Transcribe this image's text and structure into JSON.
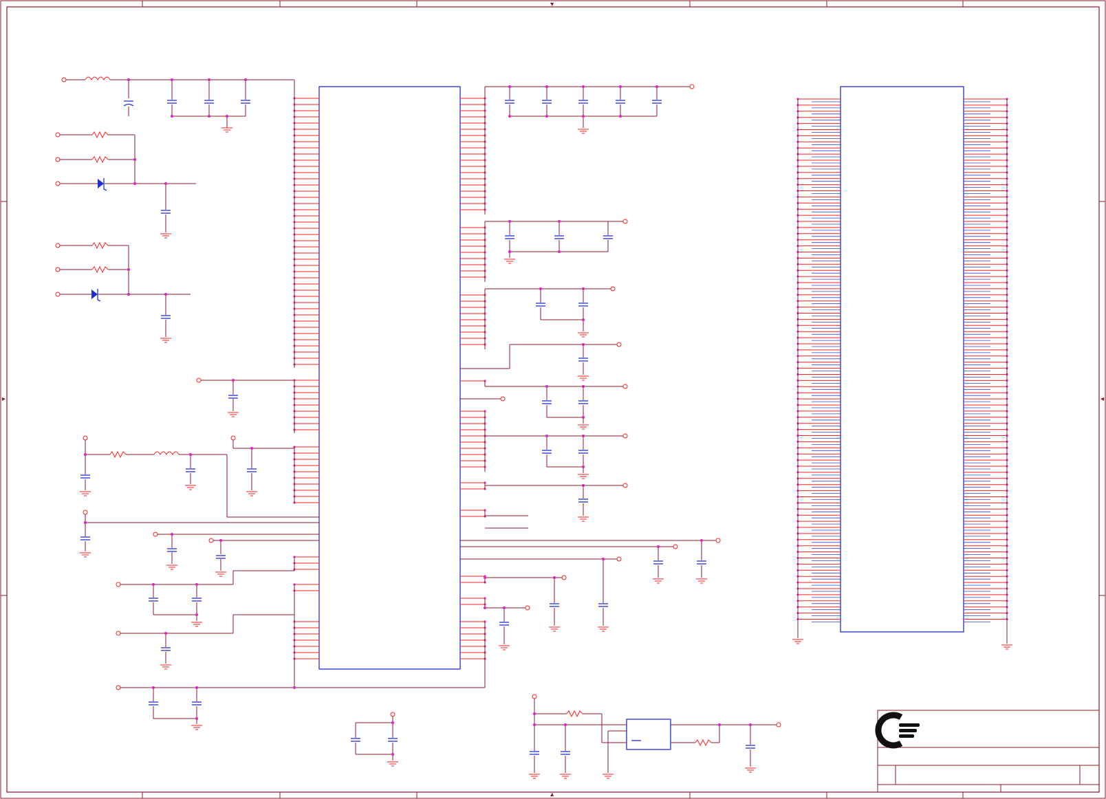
{
  "sheet": {
    "title_block": {
      "logo": "company-logo",
      "title": "",
      "revision": ""
    }
  },
  "colors": {
    "background": "#ffffff",
    "border": "#8a1a2a",
    "wire": "#8a1a2a",
    "pin": "#ff2020",
    "component": "#2030d0",
    "junction": "#e020c0",
    "bus_pin": "#3040d0"
  }
}
